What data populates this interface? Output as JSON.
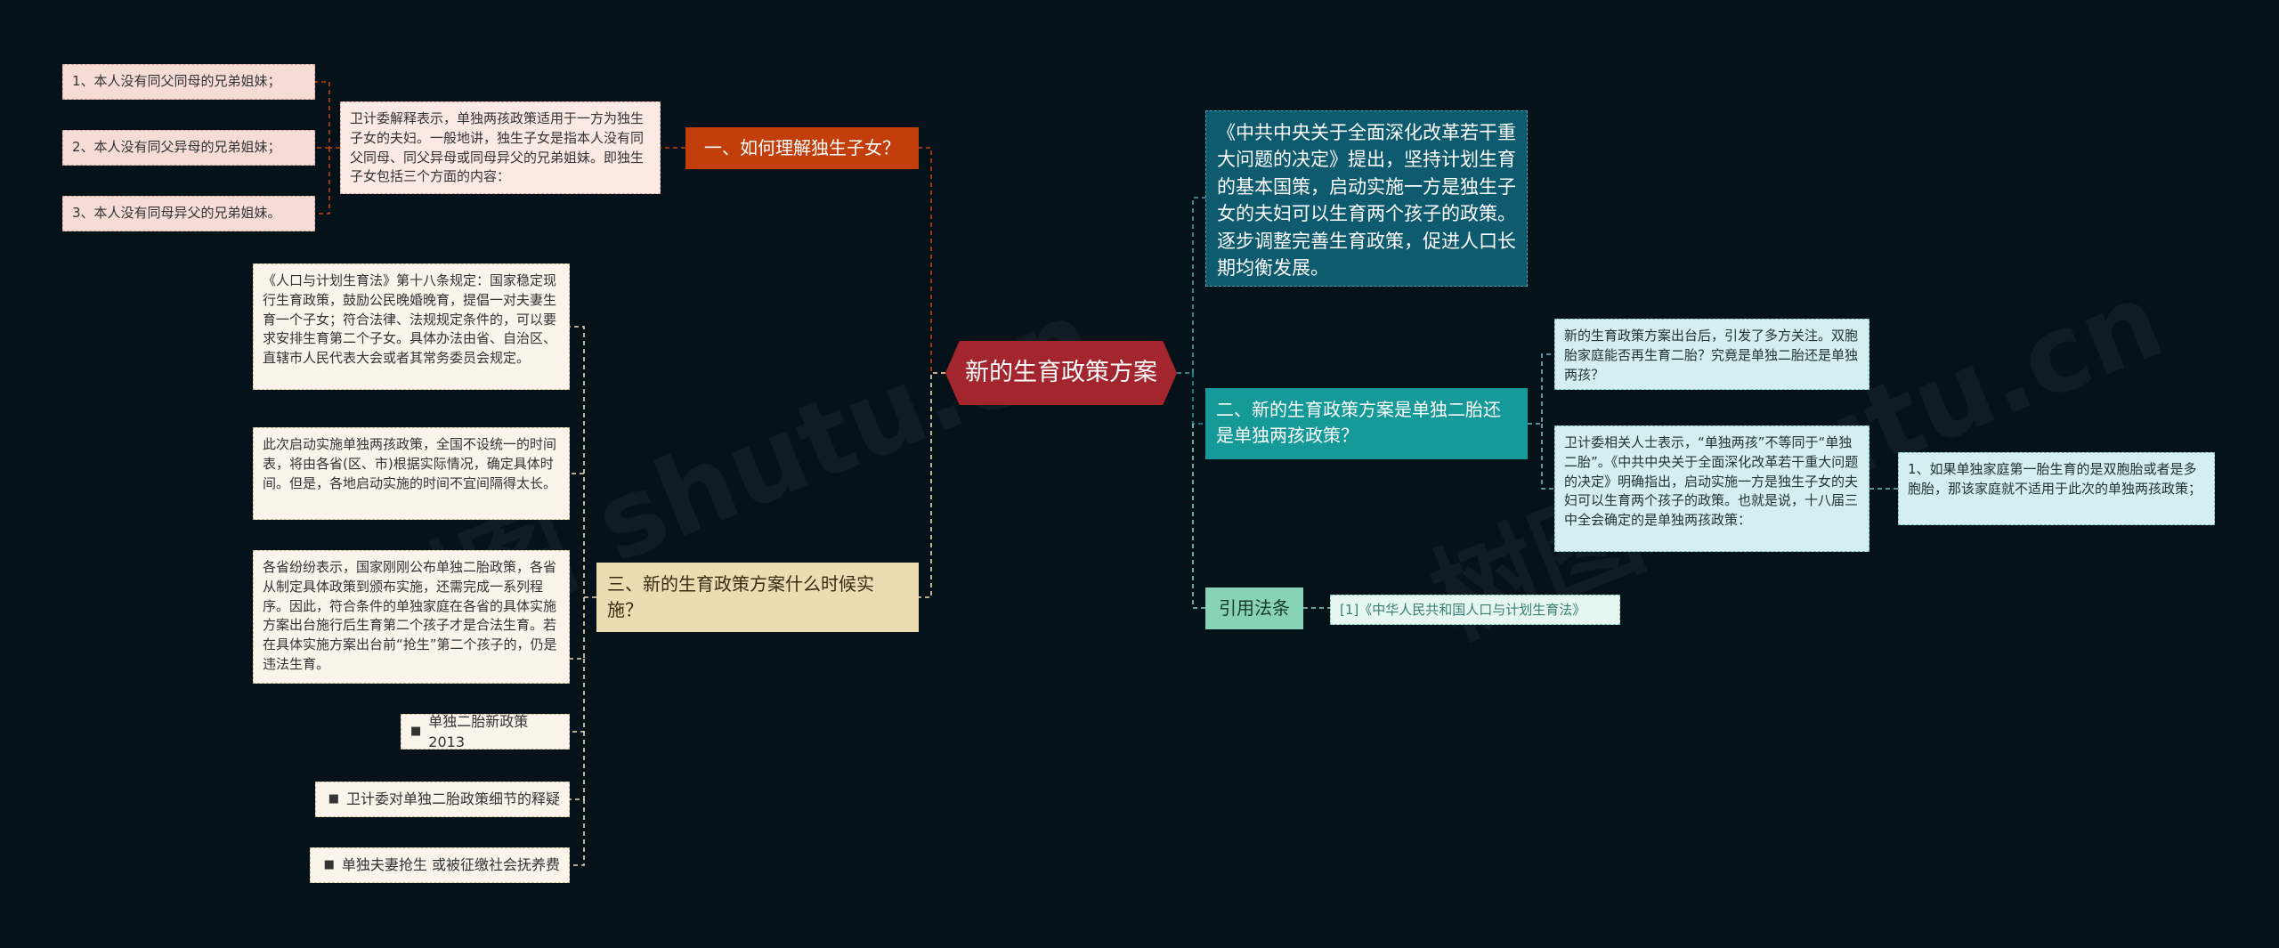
{
  "root": {
    "label": "新的生育政策方案"
  },
  "watermark": "树图 shutu.cn",
  "left": {
    "b1": {
      "label": "一、如何理解独生子女？",
      "detail": "卫计委解释表示，单独两孩政策适用于一方为独生子女的夫妇。一般地讲，独生子女是指本人没有同父同母、同父异母或同母异父的兄弟姐妹。即独生子女包括三个方面的内容：",
      "items": [
        "1、本人没有同父同母的兄弟姐妹；",
        "2、本人没有同父异母的兄弟姐妹；",
        "3、本人没有同母异父的兄弟姐妹。"
      ]
    },
    "b3": {
      "label": "三、新的生育政策方案什么时候实施？",
      "notes": [
        "《人口与计划生育法》第十八条规定：国家稳定现行生育政策，鼓励公民晚婚晚育，提倡一对夫妻生育一个子女；符合法律、法规规定条件的，可以要求安排生育第二个子女。具体办法由省、自治区、直辖市人民代表大会或者其常务委员会规定。",
        "此次启动实施单独两孩政策，全国不设统一的时间表，将由各省(区、市)根据实际情况，确定具体时间。但是，各地启动实施的时间不宜间隔得太长。",
        "各省纷纷表示，国家刚刚公布单独二胎政策，各省从制定具体政策到颁布实施，还需完成一系列程序。因此，符合条件的单独家庭在各省的具体实施方案出台施行后生育第二个孩子才是合法生育。若在具体实施方案出台前“抢生”第二个孩子的，仍是违法生育。"
      ],
      "tags": [
        "单独二胎新政策2013",
        "卫计委对单独二胎政策细节的释疑",
        "单独夫妻抢生 或被征缴社会抚养费"
      ]
    }
  },
  "right": {
    "r1": {
      "label": "《中共中央关于全面深化改革若干重大问题的决定》提出，坚持计划生育的基本国策，启动实施一方是独生子女的夫妇可以生育两个孩子的政策。逐步调整完善生育政策，促进人口长期均衡发展。"
    },
    "r2": {
      "label": "二、新的生育政策方案是单独二胎还是单独两孩政策？",
      "q": "新的生育政策方案出台后，引发了多方关注。双胞胎家庭能否再生育二胎？究竟是单独二胎还是单独两孩？",
      "a": "卫计委相关人士表示，“单独两孩”不等同于“单独二胎”。《中共中央关于全面深化改革若干重大问题的决定》明确指出，启动实施一方是独生子女的夫妇可以生育两个孩子的政策。也就是说，十八届三中全会确定的是单独两孩政策：",
      "a_child": "1、如果单独家庭第一胎生育的是双胞胎或者是多胞胎，那该家庭就不适用于此次的单独两孩政策；"
    },
    "r3": {
      "label": "引用法条",
      "cite": "[1]《中华人民共和国人口与计划生育法》"
    }
  },
  "colors": {
    "background": "#06121a",
    "root": "#a3252e",
    "branch1": "#c23f0c",
    "branch3": "#ecdcb2",
    "right1": "#0e5a6e",
    "right2": "#159a99",
    "right3": "#88d2b5"
  }
}
